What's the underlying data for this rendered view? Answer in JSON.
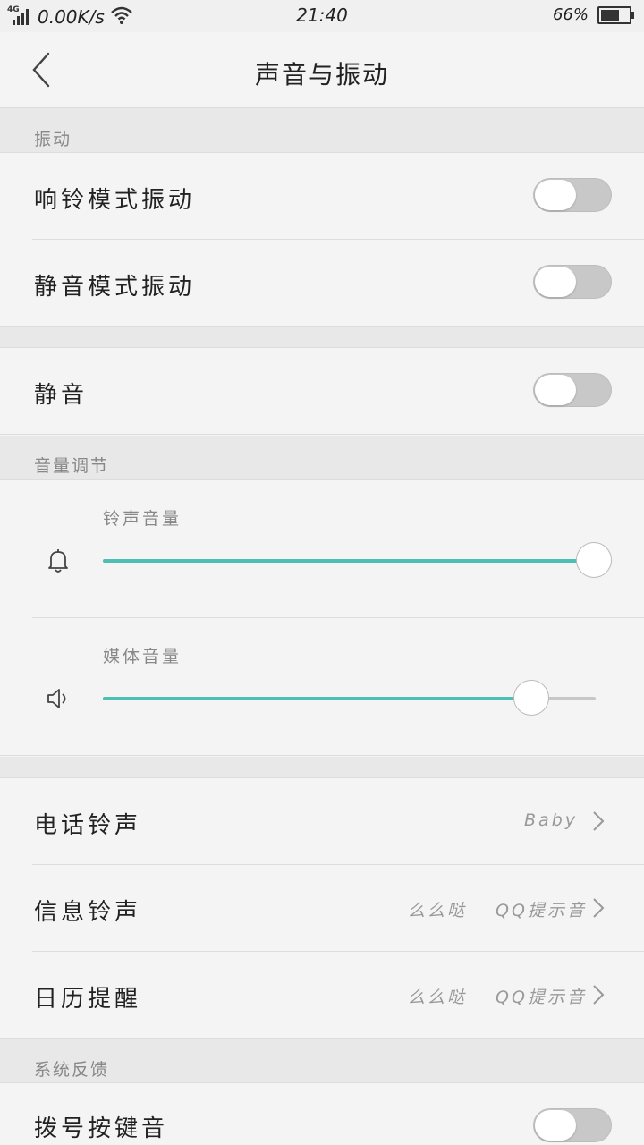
{
  "status_bar": {
    "network": "4G",
    "speed": "0.00K/s",
    "time": "21:40",
    "battery_text": "66%",
    "battery_level": 0.66
  },
  "header": {
    "title": "声音与振动"
  },
  "sections": {
    "vibration_header": "振动",
    "volume_header": "音量调节",
    "feedback_header": "系统反馈"
  },
  "vibration": {
    "ring_mode_label": "响铃模式振动",
    "ring_mode_on": false,
    "silent_mode_label": "静音模式振动",
    "silent_mode_on": false
  },
  "mute": {
    "label": "静音",
    "on": false
  },
  "volume": {
    "ringtone_label": "铃声音量",
    "ringtone_level": 1.0,
    "media_label": "媒体音量",
    "media_level": 0.87
  },
  "ringtones": {
    "phone_label": "电话铃声",
    "phone_value": "Baby",
    "message_label": "信息铃声",
    "message_value1": "么么哒",
    "message_value2": "QQ提示音",
    "calendar_label": "日历提醒",
    "calendar_value1": "么么哒",
    "calendar_value2": "QQ提示音"
  },
  "feedback": {
    "dial_label": "拨号按键音",
    "dial_on": false
  },
  "colors": {
    "accent": "#4dbfb3",
    "toggle_off": "#c8c8c8"
  }
}
